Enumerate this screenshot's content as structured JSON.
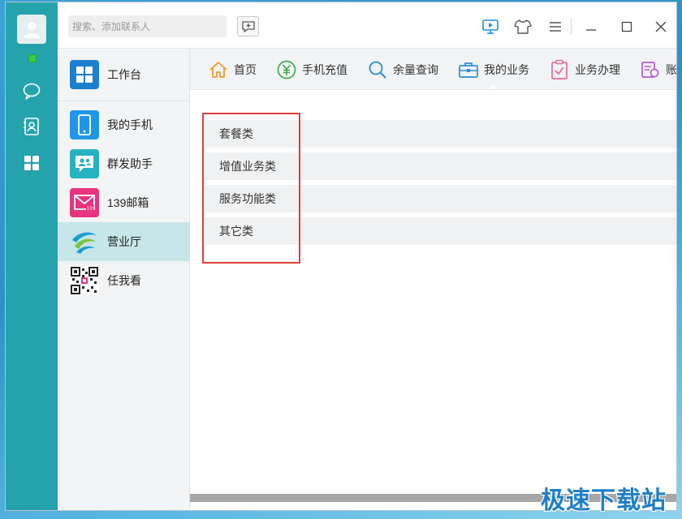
{
  "rail": {
    "avatar": "user-avatar",
    "presence_color": "#3ccb3c",
    "buttons": [
      "chat-icon",
      "contacts-icon",
      "apps-grid-icon"
    ]
  },
  "topbar": {
    "search_placeholder": "搜索、添加联系人",
    "icons": [
      "add-chat-icon",
      "video-icon",
      "skin-icon",
      "menu-icon",
      "minimize-icon",
      "maximize-icon",
      "close-icon"
    ]
  },
  "sidebar": {
    "workbench": "工作台",
    "items": [
      {
        "label": "我的手机",
        "icon": "phone-icon",
        "color": "#2196e8"
      },
      {
        "label": "群发助手",
        "icon": "group-send-icon",
        "color": "#26b2c0"
      },
      {
        "label": "139邮箱",
        "icon": "mail-icon",
        "color": "#e8337f"
      },
      {
        "label": "营业厅",
        "icon": "china-mobile-logo-icon",
        "color": "#1a9fd6"
      },
      {
        "label": "任我看",
        "icon": "qr-code-icon",
        "color": "#333333"
      }
    ]
  },
  "tabs": [
    {
      "label": "首页",
      "icon": "home-icon"
    },
    {
      "label": "手机充值",
      "icon": "yuan-icon"
    },
    {
      "label": "余量查询",
      "icon": "search-icon"
    },
    {
      "label": "我的业务",
      "icon": "briefcase-icon",
      "active": true
    },
    {
      "label": "业务办理",
      "icon": "clipboard-check-icon"
    },
    {
      "label": "账",
      "icon": "bill-icon"
    }
  ],
  "categories": [
    "套餐类",
    "增值业务类",
    "服务功能类",
    "其它类"
  ],
  "watermark": "极速下载站"
}
